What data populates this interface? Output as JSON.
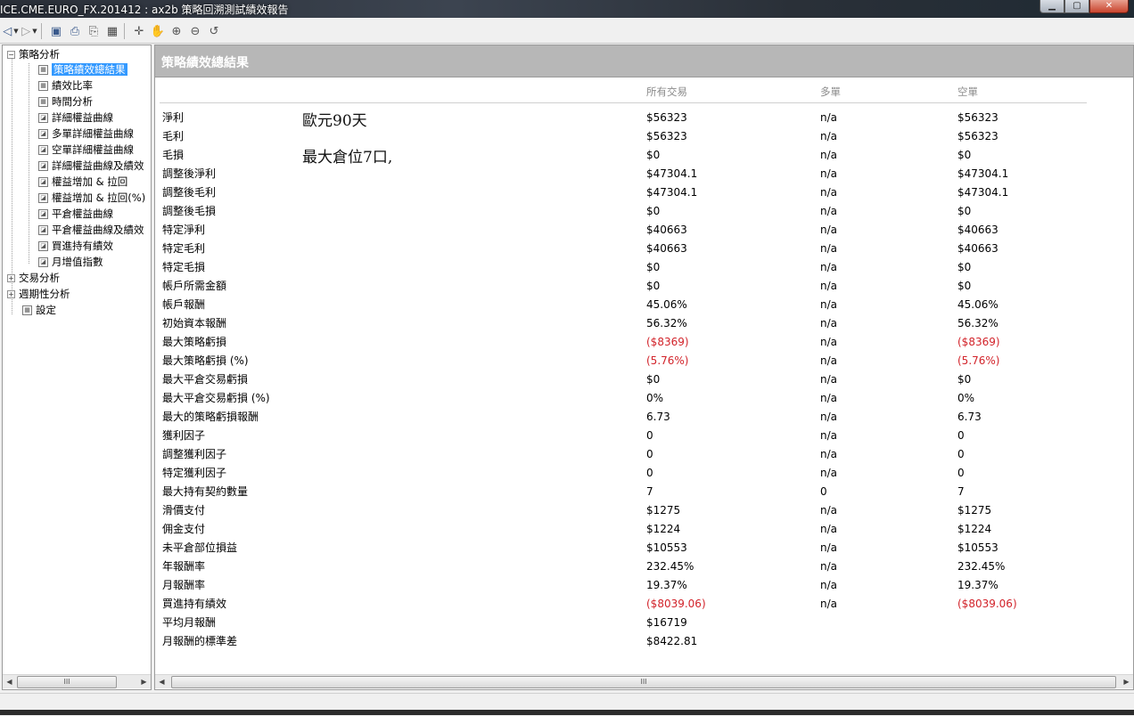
{
  "window": {
    "title": "ICE.CME.EURO_FX.201412 : ax2b 策略回溯測試績效報告",
    "buttons": [
      "minimize",
      "maximize",
      "close"
    ]
  },
  "toolbar": {
    "icons": [
      "back-icon",
      "forward-icon",
      "save-icon",
      "print-preview-icon",
      "print-icon",
      "table-icon",
      "crosshair-icon",
      "hand-icon",
      "zoom-in-icon",
      "zoom-out-icon",
      "reset-icon"
    ]
  },
  "tree": {
    "root1": "策略分析",
    "items": [
      {
        "label": "策略績效總結果",
        "icon": "table-icon",
        "selected": true
      },
      {
        "label": "績效比率",
        "icon": "table-icon"
      },
      {
        "label": "時間分析",
        "icon": "table-icon"
      },
      {
        "label": "詳細權益曲線",
        "icon": "chart-icon"
      },
      {
        "label": "多單詳細權益曲線",
        "icon": "chart-icon"
      },
      {
        "label": "空單詳細權益曲線",
        "icon": "chart-icon"
      },
      {
        "label": "詳細權益曲線及績效",
        "icon": "chart-icon"
      },
      {
        "label": "權益增加 & 拉回",
        "icon": "chart-icon"
      },
      {
        "label": "權益增加 & 拉回(%)",
        "icon": "chart-icon"
      },
      {
        "label": "平倉權益曲線",
        "icon": "chart-icon"
      },
      {
        "label": "平倉權益曲線及績效",
        "icon": "chart-icon"
      },
      {
        "label": "買進持有績效",
        "icon": "chart-icon"
      },
      {
        "label": "月增值指數",
        "icon": "chart-icon"
      }
    ],
    "root2": "交易分析",
    "root3": "週期性分析",
    "root4": "設定"
  },
  "report": {
    "title": "策略績效總結果",
    "columns": [
      "所有交易",
      "多單",
      "空單"
    ],
    "notes": [
      "歐元90天",
      "最大倉位7口,"
    ],
    "rows": [
      {
        "label": "淨利",
        "all": "$56323",
        "long": "n/a",
        "short": "$56323"
      },
      {
        "label": "毛利",
        "all": "$56323",
        "long": "n/a",
        "short": "$56323"
      },
      {
        "label": "毛損",
        "all": "$0",
        "long": "n/a",
        "short": "$0"
      },
      {
        "label": "調整後淨利",
        "all": "$47304.1",
        "long": "n/a",
        "short": "$47304.1"
      },
      {
        "label": "調整後毛利",
        "all": "$47304.1",
        "long": "n/a",
        "short": "$47304.1"
      },
      {
        "label": "調整後毛損",
        "all": "$0",
        "long": "n/a",
        "short": "$0"
      },
      {
        "label": "特定淨利",
        "all": "$40663",
        "long": "n/a",
        "short": "$40663"
      },
      {
        "label": "特定毛利",
        "all": "$40663",
        "long": "n/a",
        "short": "$40663"
      },
      {
        "label": "特定毛損",
        "all": "$0",
        "long": "n/a",
        "short": "$0"
      },
      {
        "label": "帳戶所需金額",
        "all": "$0",
        "long": "n/a",
        "short": "$0"
      },
      {
        "label": "帳戶報酬",
        "all": "45.06%",
        "long": "n/a",
        "short": "45.06%"
      },
      {
        "label": "初始資本報酬",
        "all": "56.32%",
        "long": "n/a",
        "short": "56.32%"
      },
      {
        "label": "最大策略虧損",
        "all": "($8369)",
        "long": "n/a",
        "short": "($8369)",
        "negative": true
      },
      {
        "label": "最大策略虧損 (%)",
        "all": "(5.76%)",
        "long": "n/a",
        "short": "(5.76%)",
        "negative": true
      },
      {
        "label": "最大平倉交易虧損",
        "all": "$0",
        "long": "n/a",
        "short": "$0"
      },
      {
        "label": "最大平倉交易虧損 (%)",
        "all": "0%",
        "long": "n/a",
        "short": "0%"
      },
      {
        "label": "最大的策略虧損報酬",
        "all": "6.73",
        "long": "n/a",
        "short": "6.73"
      },
      {
        "label": "獲利因子",
        "all": "0",
        "long": "n/a",
        "short": "0"
      },
      {
        "label": "調整獲利因子",
        "all": "0",
        "long": "n/a",
        "short": "0"
      },
      {
        "label": "特定獲利因子",
        "all": "0",
        "long": "n/a",
        "short": "0"
      },
      {
        "label": "最大持有契約數量",
        "all": "7",
        "long": "0",
        "short": "7"
      },
      {
        "label": "滑價支付",
        "all": "$1275",
        "long": "n/a",
        "short": "$1275"
      },
      {
        "label": "佣金支付",
        "all": "$1224",
        "long": "n/a",
        "short": "$1224"
      },
      {
        "label": "未平倉部位損益",
        "all": "$10553",
        "long": "n/a",
        "short": "$10553"
      },
      {
        "label": "年報酬率",
        "all": "232.45%",
        "long": "n/a",
        "short": "232.45%"
      },
      {
        "label": "月報酬率",
        "all": "19.37%",
        "long": "n/a",
        "short": "19.37%"
      },
      {
        "label": "買進持有績效",
        "all": "($8039.06)",
        "long": "n/a",
        "short": "($8039.06)",
        "negative": true
      },
      {
        "label": "平均月報酬",
        "all": "$16719",
        "long": "",
        "short": ""
      },
      {
        "label": "月報酬的標準差",
        "all": "$8422.81",
        "long": "",
        "short": ""
      }
    ]
  },
  "scroll": {
    "left_thumb": "III",
    "right_thumb": "III"
  },
  "colors": {
    "negative": "#d2232a",
    "selection": "#3399ff",
    "header_bg": "#b7b7b7"
  }
}
